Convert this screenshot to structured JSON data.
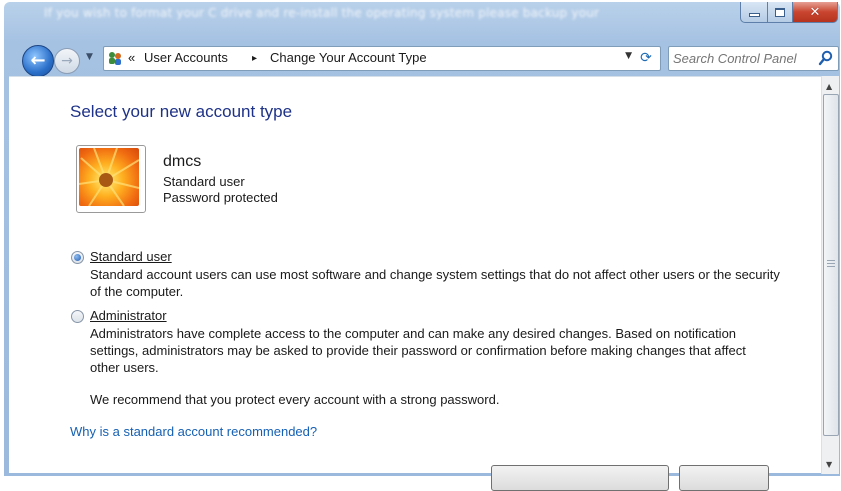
{
  "window": {
    "title_text": "If you wish to format your C drive and re-install the operating system please backup your"
  },
  "nav": {
    "back_glyph": "←",
    "forward_glyph": "→",
    "breadcrumb": {
      "sep": "«",
      "item1": "User Accounts",
      "arrow": "▸",
      "item2": "Change Your Account Type"
    },
    "search_placeholder": "Search Control Panel"
  },
  "content": {
    "heading": "Select your new account type",
    "user": {
      "name": "dmcs",
      "type": "Standard user",
      "status": "Password protected"
    },
    "options": [
      {
        "label": "Standard user",
        "description": "Standard account users can use most software and change system settings that do not affect other users or the security of the computer.",
        "selected": true
      },
      {
        "label": "Administrator",
        "description": "Administrators have complete access to the computer and can make any desired changes. Based on notification settings, administrators may be asked to provide their password or confirmation before making changes that affect other users.",
        "selected": false
      }
    ],
    "recommendation": "We recommend that you protect every account with a strong password.",
    "help_link": "Why is a standard account recommended?"
  },
  "colors": {
    "heading": "#1e3287",
    "link": "#1560b3",
    "frame": "#a6c2e3"
  }
}
